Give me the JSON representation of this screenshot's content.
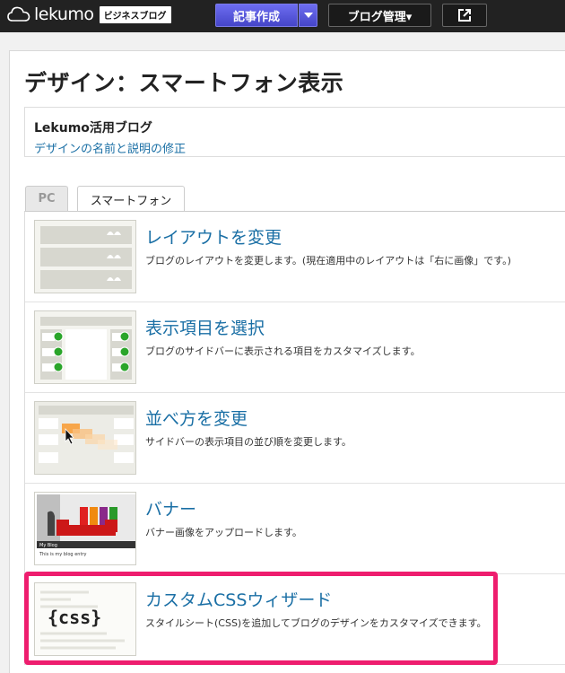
{
  "topbar": {
    "brand": "lekumo",
    "brand_badge": "ビジネスブログ",
    "compose_label": "記事作成",
    "manage_label": "ブログ管理▾",
    "external_icon": "external-link-icon"
  },
  "page": {
    "title": "デザイン：スマートフォン表示",
    "blog_name": "Lekumo活用ブログ",
    "blog_edit_link": "デザインの名前と説明の修正"
  },
  "tabs": [
    {
      "label": "PC",
      "active": false
    },
    {
      "label": "スマートフォン",
      "active": true
    }
  ],
  "items": [
    {
      "title": "レイアウトを変更",
      "desc": "ブログのレイアウトを変更します。(現在適用中のレイアウトは「右に画像」です。)"
    },
    {
      "title": "表示項目を選択",
      "desc": "ブログのサイドバーに表示される項目をカスタマイズします。"
    },
    {
      "title": "並べ方を変更",
      "desc": "サイドバーの表示項目の並び順を変更します。"
    },
    {
      "title": "バナー",
      "desc": "バナー画像をアップロードします。",
      "banner_caption": "My Blog",
      "banner_subcaption": "This is my blog entry"
    },
    {
      "title": "カスタムCSSウィザード",
      "desc": "スタイルシート(CSS)を追加してブログのデザインをカスタマイズできます。",
      "css_glyph": "{css}"
    }
  ],
  "colors": {
    "accent_link": "#1a6fa5",
    "compose_button": "#5555dd",
    "highlight": "#ee1d6e"
  }
}
